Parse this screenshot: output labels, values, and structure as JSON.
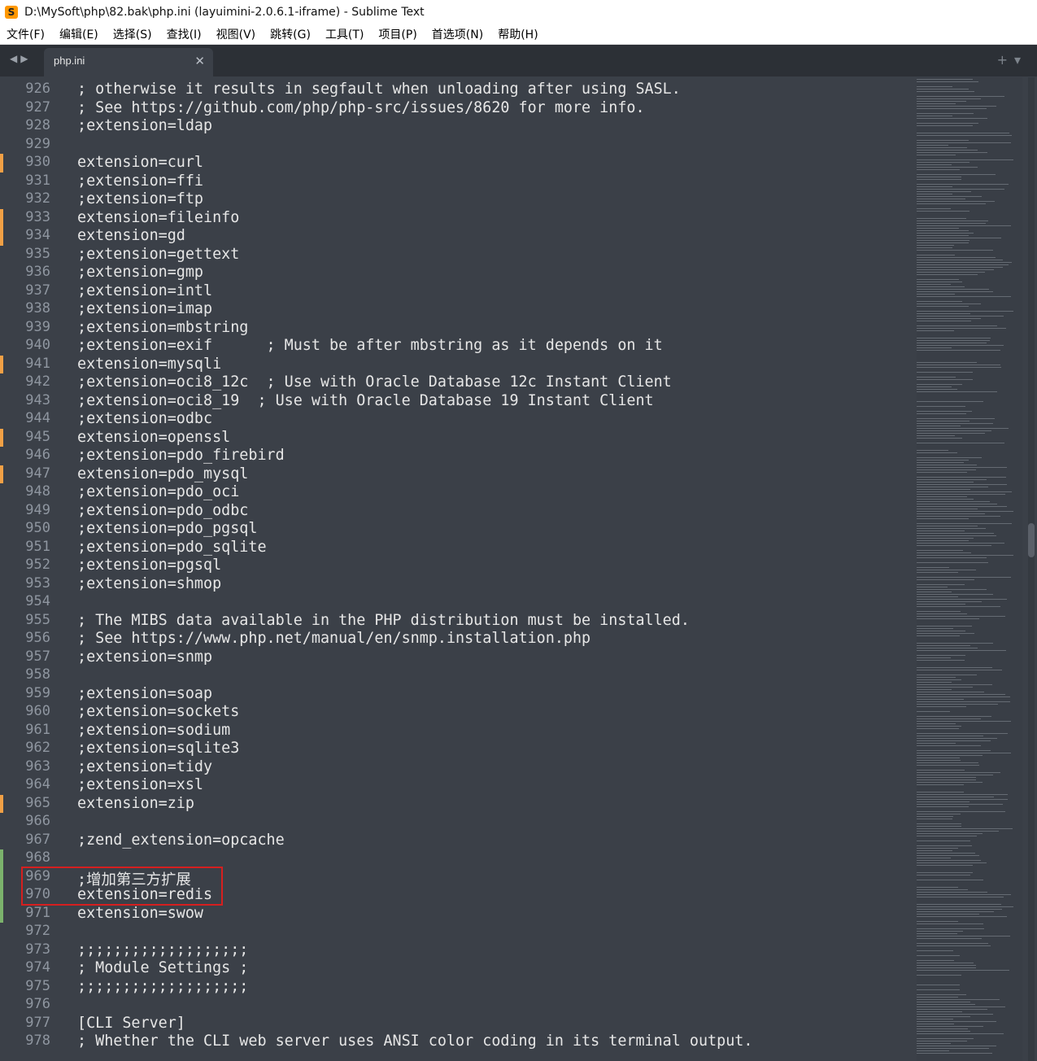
{
  "window": {
    "title": "D:\\MySoft\\php\\82.bak\\php.ini (layuimini-2.0.6.1-iframe) - Sublime Text"
  },
  "menu": [
    "文件(F)",
    "编辑(E)",
    "选择(S)",
    "查找(I)",
    "视图(V)",
    "跳转(G)",
    "工具(T)",
    "项目(P)",
    "首选项(N)",
    "帮助(H)"
  ],
  "tab": {
    "label": "php.ini"
  },
  "lines": [
    {
      "num": "926",
      "text": "; otherwise it results in segfault when unloading after using SASL.",
      "mark": ""
    },
    {
      "num": "927",
      "text": "; See https://github.com/php/php-src/issues/8620 for more info.",
      "mark": ""
    },
    {
      "num": "928",
      "text": ";extension=ldap",
      "mark": ""
    },
    {
      "num": "929",
      "text": "",
      "mark": ""
    },
    {
      "num": "930",
      "text": "extension=curl",
      "mark": "mod"
    },
    {
      "num": "931",
      "text": ";extension=ffi",
      "mark": ""
    },
    {
      "num": "932",
      "text": ";extension=ftp",
      "mark": ""
    },
    {
      "num": "933",
      "text": "extension=fileinfo",
      "mark": "mod"
    },
    {
      "num": "934",
      "text": "extension=gd",
      "mark": "mod"
    },
    {
      "num": "935",
      "text": ";extension=gettext",
      "mark": ""
    },
    {
      "num": "936",
      "text": ";extension=gmp",
      "mark": ""
    },
    {
      "num": "937",
      "text": ";extension=intl",
      "mark": ""
    },
    {
      "num": "938",
      "text": ";extension=imap",
      "mark": ""
    },
    {
      "num": "939",
      "text": ";extension=mbstring",
      "mark": ""
    },
    {
      "num": "940",
      "text": ";extension=exif      ; Must be after mbstring as it depends on it",
      "mark": ""
    },
    {
      "num": "941",
      "text": "extension=mysqli",
      "mark": "mod"
    },
    {
      "num": "942",
      "text": ";extension=oci8_12c  ; Use with Oracle Database 12c Instant Client",
      "mark": ""
    },
    {
      "num": "943",
      "text": ";extension=oci8_19  ; Use with Oracle Database 19 Instant Client",
      "mark": ""
    },
    {
      "num": "944",
      "text": ";extension=odbc",
      "mark": ""
    },
    {
      "num": "945",
      "text": "extension=openssl",
      "mark": "mod"
    },
    {
      "num": "946",
      "text": ";extension=pdo_firebird",
      "mark": ""
    },
    {
      "num": "947",
      "text": "extension=pdo_mysql",
      "mark": "mod"
    },
    {
      "num": "948",
      "text": ";extension=pdo_oci",
      "mark": ""
    },
    {
      "num": "949",
      "text": ";extension=pdo_odbc",
      "mark": ""
    },
    {
      "num": "950",
      "text": ";extension=pdo_pgsql",
      "mark": ""
    },
    {
      "num": "951",
      "text": ";extension=pdo_sqlite",
      "mark": ""
    },
    {
      "num": "952",
      "text": ";extension=pgsql",
      "mark": ""
    },
    {
      "num": "953",
      "text": ";extension=shmop",
      "mark": ""
    },
    {
      "num": "954",
      "text": "",
      "mark": ""
    },
    {
      "num": "955",
      "text": "; The MIBS data available in the PHP distribution must be installed.",
      "mark": ""
    },
    {
      "num": "956",
      "text": "; See https://www.php.net/manual/en/snmp.installation.php",
      "mark": ""
    },
    {
      "num": "957",
      "text": ";extension=snmp",
      "mark": ""
    },
    {
      "num": "958",
      "text": "",
      "mark": ""
    },
    {
      "num": "959",
      "text": ";extension=soap",
      "mark": ""
    },
    {
      "num": "960",
      "text": ";extension=sockets",
      "mark": ""
    },
    {
      "num": "961",
      "text": ";extension=sodium",
      "mark": ""
    },
    {
      "num": "962",
      "text": ";extension=sqlite3",
      "mark": ""
    },
    {
      "num": "963",
      "text": ";extension=tidy",
      "mark": ""
    },
    {
      "num": "964",
      "text": ";extension=xsl",
      "mark": ""
    },
    {
      "num": "965",
      "text": "extension=zip",
      "mark": "mod"
    },
    {
      "num": "966",
      "text": "",
      "mark": ""
    },
    {
      "num": "967",
      "text": ";zend_extension=opcache",
      "mark": ""
    },
    {
      "num": "968",
      "text": "",
      "mark": "add"
    },
    {
      "num": "969",
      "text": ";增加第三方扩展",
      "mark": "add"
    },
    {
      "num": "970",
      "text": "extension=redis",
      "mark": "add"
    },
    {
      "num": "971",
      "text": "extension=swow",
      "mark": "add"
    },
    {
      "num": "972",
      "text": "",
      "mark": ""
    },
    {
      "num": "973",
      "text": ";;;;;;;;;;;;;;;;;;;",
      "mark": ""
    },
    {
      "num": "974",
      "text": "; Module Settings ;",
      "mark": ""
    },
    {
      "num": "975",
      "text": ";;;;;;;;;;;;;;;;;;;",
      "mark": ""
    },
    {
      "num": "976",
      "text": "",
      "mark": ""
    },
    {
      "num": "977",
      "text": "[CLI Server]",
      "mark": ""
    },
    {
      "num": "978",
      "text": "; Whether the CLI web server uses ANSI color coding in its terminal output.",
      "mark": ""
    }
  ],
  "colors": {
    "background": "#3b4048",
    "gutter_modified": "#f1a045",
    "gutter_added": "#7bb26c",
    "highlight_box": "#d61f1f"
  }
}
